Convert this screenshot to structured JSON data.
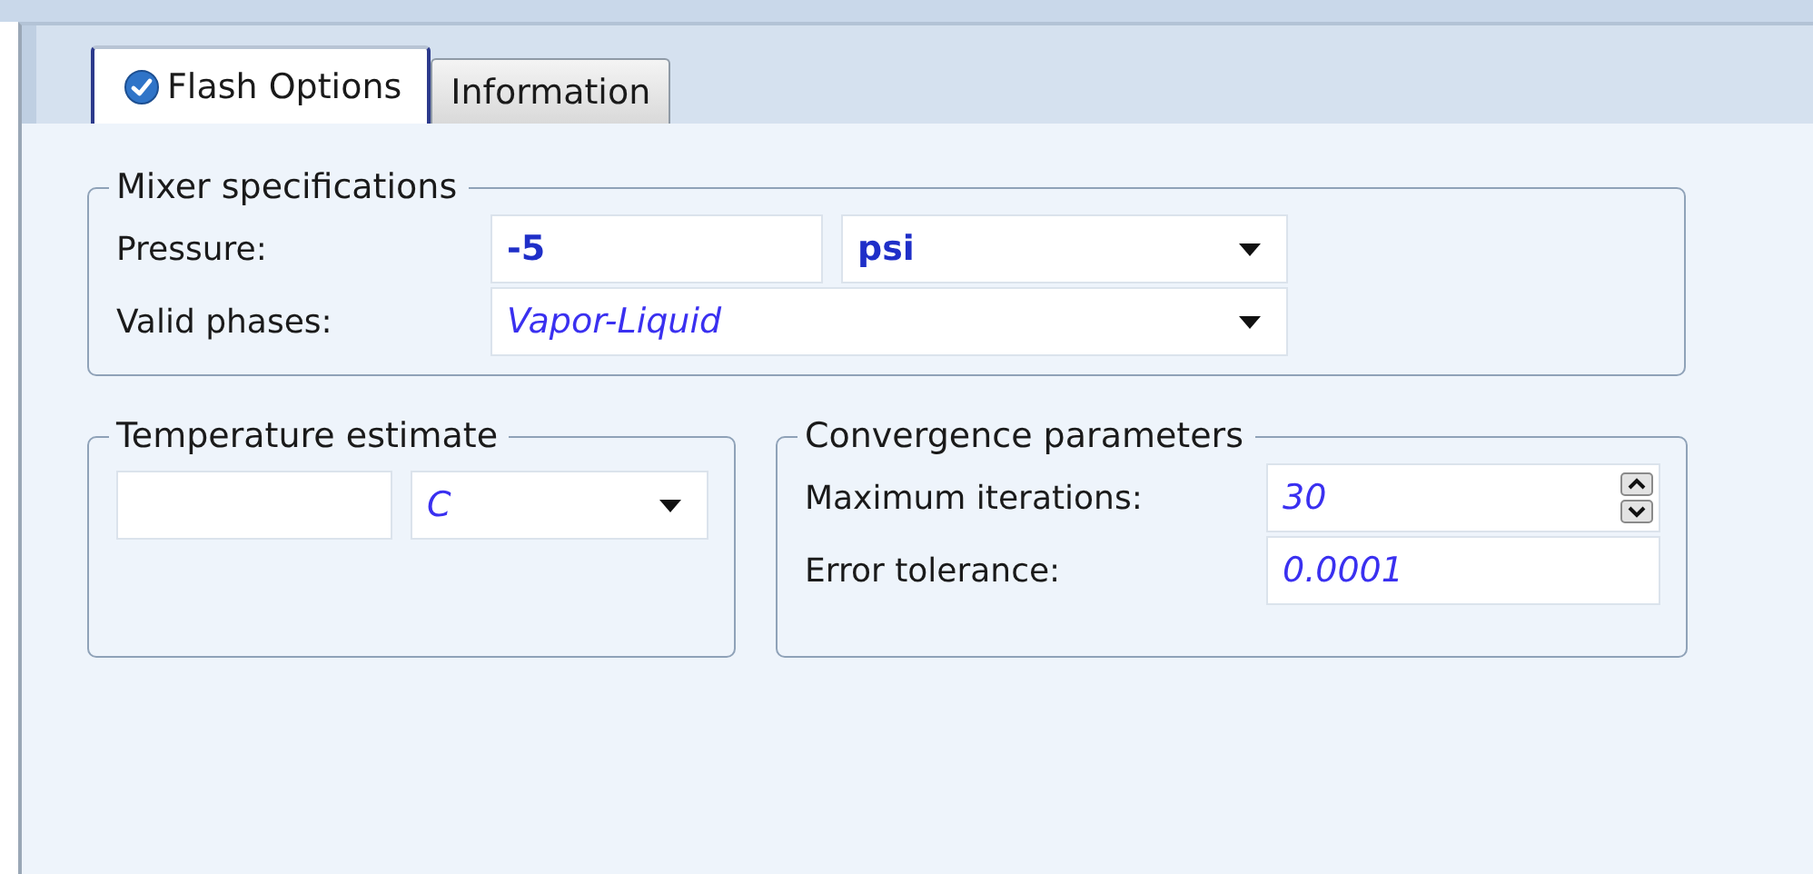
{
  "tabs": [
    {
      "label": "Flash Options",
      "selected": true,
      "checked": true
    },
    {
      "label": "Information",
      "selected": false,
      "checked": false
    }
  ],
  "mixer_specifications": {
    "title": "Mixer specifications",
    "rows": [
      {
        "kind": "value-unit",
        "label": "Pressure:",
        "value": {
          "text": "-5",
          "default": false
        },
        "unit": {
          "text": "psi",
          "default": false
        }
      },
      {
        "kind": "dropdown",
        "label": "Valid phases:",
        "value": {
          "text": "Vapor-Liquid",
          "default": true
        }
      }
    ]
  },
  "temperature_estimate": {
    "title": "Temperature estimate",
    "unit": {
      "text": "C",
      "default": true
    }
  },
  "convergence_parameters": {
    "title": "Convergence parameters",
    "rows": [
      {
        "kind": "spinner",
        "label": "Maximum iterations:",
        "value": {
          "text": "30",
          "default": true
        }
      },
      {
        "kind": "text",
        "label": "Error tolerance:",
        "value": {
          "text": "0.0001",
          "default": true
        }
      }
    ]
  }
}
